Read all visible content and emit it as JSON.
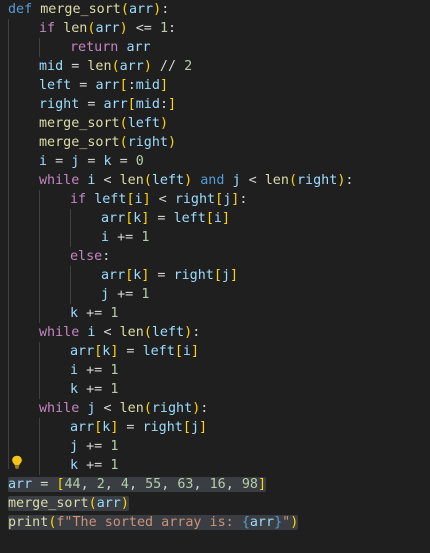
{
  "editor": {
    "language": "python",
    "indent_unit": "    ",
    "lines": [
      {
        "tokens": [
          [
            "kw",
            "def"
          ],
          [
            "op",
            " "
          ],
          [
            "fn",
            "merge_sort"
          ],
          [
            "br1",
            "("
          ],
          [
            "var",
            "arr"
          ],
          [
            "br1",
            ")"
          ],
          [
            "op",
            ":"
          ]
        ]
      },
      {
        "indent": 1,
        "tokens": [
          [
            "ctl",
            "if"
          ],
          [
            "op",
            " "
          ],
          [
            "fn",
            "len"
          ],
          [
            "br1",
            "("
          ],
          [
            "var",
            "arr"
          ],
          [
            "br1",
            ")"
          ],
          [
            "op",
            " <= "
          ],
          [
            "num",
            "1"
          ],
          [
            "op",
            ":"
          ]
        ]
      },
      {
        "indent": 2,
        "tokens": [
          [
            "ctl",
            "return"
          ],
          [
            "op",
            " "
          ],
          [
            "var",
            "arr"
          ]
        ]
      },
      {
        "indent": 1,
        "tokens": [
          [
            "var",
            "mid"
          ],
          [
            "op",
            " = "
          ],
          [
            "fn",
            "len"
          ],
          [
            "br1",
            "("
          ],
          [
            "var",
            "arr"
          ],
          [
            "br1",
            ")"
          ],
          [
            "op",
            " // "
          ],
          [
            "num",
            "2"
          ]
        ]
      },
      {
        "indent": 1,
        "tokens": [
          [
            "var",
            "left"
          ],
          [
            "op",
            " = "
          ],
          [
            "var",
            "arr"
          ],
          [
            "br1",
            "["
          ],
          [
            "op",
            ":"
          ],
          [
            "var",
            "mid"
          ],
          [
            "br1",
            "]"
          ]
        ]
      },
      {
        "indent": 1,
        "tokens": [
          [
            "var",
            "right"
          ],
          [
            "op",
            " = "
          ],
          [
            "var",
            "arr"
          ],
          [
            "br1",
            "["
          ],
          [
            "var",
            "mid"
          ],
          [
            "op",
            ":"
          ],
          [
            "br1",
            "]"
          ]
        ]
      },
      {
        "indent": 1,
        "tokens": [
          [
            "fn",
            "merge_sort"
          ],
          [
            "br1",
            "("
          ],
          [
            "var",
            "left"
          ],
          [
            "br1",
            ")"
          ]
        ]
      },
      {
        "indent": 1,
        "tokens": [
          [
            "fn",
            "merge_sort"
          ],
          [
            "br1",
            "("
          ],
          [
            "var",
            "right"
          ],
          [
            "br1",
            ")"
          ]
        ]
      },
      {
        "indent": 1,
        "tokens": [
          [
            "var",
            "i"
          ],
          [
            "op",
            " = "
          ],
          [
            "var",
            "j"
          ],
          [
            "op",
            " = "
          ],
          [
            "var",
            "k"
          ],
          [
            "op",
            " = "
          ],
          [
            "num",
            "0"
          ]
        ]
      },
      {
        "indent": 1,
        "tokens": [
          [
            "ctl",
            "while"
          ],
          [
            "op",
            " "
          ],
          [
            "var",
            "i"
          ],
          [
            "op",
            " < "
          ],
          [
            "fn",
            "len"
          ],
          [
            "br1",
            "("
          ],
          [
            "var",
            "left"
          ],
          [
            "br1",
            ")"
          ],
          [
            "op",
            " "
          ],
          [
            "kw",
            "and"
          ],
          [
            "op",
            " "
          ],
          [
            "var",
            "j"
          ],
          [
            "op",
            " < "
          ],
          [
            "fn",
            "len"
          ],
          [
            "br1",
            "("
          ],
          [
            "var",
            "right"
          ],
          [
            "br1",
            ")"
          ],
          [
            "op",
            ":"
          ]
        ]
      },
      {
        "indent": 2,
        "tokens": [
          [
            "ctl",
            "if"
          ],
          [
            "op",
            " "
          ],
          [
            "var",
            "left"
          ],
          [
            "br1",
            "["
          ],
          [
            "var",
            "i"
          ],
          [
            "br1",
            "]"
          ],
          [
            "op",
            " < "
          ],
          [
            "var",
            "right"
          ],
          [
            "br1",
            "["
          ],
          [
            "var",
            "j"
          ],
          [
            "br1",
            "]"
          ],
          [
            "op",
            ":"
          ]
        ]
      },
      {
        "indent": 3,
        "tokens": [
          [
            "var",
            "arr"
          ],
          [
            "br1",
            "["
          ],
          [
            "var",
            "k"
          ],
          [
            "br1",
            "]"
          ],
          [
            "op",
            " = "
          ],
          [
            "var",
            "left"
          ],
          [
            "br1",
            "["
          ],
          [
            "var",
            "i"
          ],
          [
            "br1",
            "]"
          ]
        ]
      },
      {
        "indent": 3,
        "tokens": [
          [
            "var",
            "i"
          ],
          [
            "op",
            " += "
          ],
          [
            "num",
            "1"
          ]
        ]
      },
      {
        "indent": 2,
        "tokens": [
          [
            "ctl",
            "else"
          ],
          [
            "op",
            ":"
          ]
        ]
      },
      {
        "indent": 3,
        "tokens": [
          [
            "var",
            "arr"
          ],
          [
            "br1",
            "["
          ],
          [
            "var",
            "k"
          ],
          [
            "br1",
            "]"
          ],
          [
            "op",
            " = "
          ],
          [
            "var",
            "right"
          ],
          [
            "br1",
            "["
          ],
          [
            "var",
            "j"
          ],
          [
            "br1",
            "]"
          ]
        ]
      },
      {
        "indent": 3,
        "tokens": [
          [
            "var",
            "j"
          ],
          [
            "op",
            " += "
          ],
          [
            "num",
            "1"
          ]
        ]
      },
      {
        "indent": 2,
        "tokens": [
          [
            "var",
            "k"
          ],
          [
            "op",
            " += "
          ],
          [
            "num",
            "1"
          ]
        ]
      },
      {
        "indent": 1,
        "tokens": [
          [
            "ctl",
            "while"
          ],
          [
            "op",
            " "
          ],
          [
            "var",
            "i"
          ],
          [
            "op",
            " < "
          ],
          [
            "fn",
            "len"
          ],
          [
            "br1",
            "("
          ],
          [
            "var",
            "left"
          ],
          [
            "br1",
            ")"
          ],
          [
            "op",
            ":"
          ]
        ]
      },
      {
        "indent": 2,
        "tokens": [
          [
            "var",
            "arr"
          ],
          [
            "br1",
            "["
          ],
          [
            "var",
            "k"
          ],
          [
            "br1",
            "]"
          ],
          [
            "op",
            " = "
          ],
          [
            "var",
            "left"
          ],
          [
            "br1",
            "["
          ],
          [
            "var",
            "i"
          ],
          [
            "br1",
            "]"
          ]
        ]
      },
      {
        "indent": 2,
        "tokens": [
          [
            "var",
            "i"
          ],
          [
            "op",
            " += "
          ],
          [
            "num",
            "1"
          ]
        ]
      },
      {
        "indent": 2,
        "tokens": [
          [
            "var",
            "k"
          ],
          [
            "op",
            " += "
          ],
          [
            "num",
            "1"
          ]
        ]
      },
      {
        "indent": 1,
        "tokens": [
          [
            "ctl",
            "while"
          ],
          [
            "op",
            " "
          ],
          [
            "var",
            "j"
          ],
          [
            "op",
            " < "
          ],
          [
            "fn",
            "len"
          ],
          [
            "br1",
            "("
          ],
          [
            "var",
            "right"
          ],
          [
            "br1",
            ")"
          ],
          [
            "op",
            ":"
          ]
        ]
      },
      {
        "indent": 2,
        "tokens": [
          [
            "var",
            "arr"
          ],
          [
            "br1",
            "["
          ],
          [
            "var",
            "k"
          ],
          [
            "br1",
            "]"
          ],
          [
            "op",
            " = "
          ],
          [
            "var",
            "right"
          ],
          [
            "br1",
            "["
          ],
          [
            "var",
            "j"
          ],
          [
            "br1",
            "]"
          ]
        ]
      },
      {
        "indent": 2,
        "tokens": [
          [
            "var",
            "j"
          ],
          [
            "op",
            " += "
          ],
          [
            "num",
            "1"
          ]
        ]
      },
      {
        "indent": 2,
        "tokens": [
          [
            "var",
            "k"
          ],
          [
            "op",
            " += "
          ],
          [
            "num",
            "1"
          ]
        ]
      },
      {
        "selected": true,
        "tokens": [
          [
            "var",
            "arr"
          ],
          [
            "op",
            " = "
          ],
          [
            "br1",
            "["
          ],
          [
            "num",
            "44"
          ],
          [
            "op",
            ", "
          ],
          [
            "num",
            "2"
          ],
          [
            "op",
            ", "
          ],
          [
            "num",
            "4"
          ],
          [
            "op",
            ", "
          ],
          [
            "num",
            "55"
          ],
          [
            "op",
            ", "
          ],
          [
            "num",
            "63"
          ],
          [
            "op",
            ", "
          ],
          [
            "num",
            "16"
          ],
          [
            "op",
            ", "
          ],
          [
            "num",
            "98"
          ],
          [
            "br1",
            "]"
          ]
        ]
      },
      {
        "selected": true,
        "tokens": [
          [
            "fn",
            "merge_sort"
          ],
          [
            "br1",
            "("
          ],
          [
            "var",
            "arr"
          ],
          [
            "br1",
            ")"
          ]
        ]
      },
      {
        "selected": true,
        "tokens": [
          [
            "fn",
            "print"
          ],
          [
            "br1",
            "("
          ],
          [
            "str",
            "f\"The sorted array is: "
          ],
          [
            "kw",
            "{"
          ],
          [
            "var",
            "arr"
          ],
          [
            "kw",
            "}"
          ],
          [
            "str",
            "\""
          ],
          [
            "br1",
            ")"
          ]
        ]
      }
    ],
    "lightbulb_icon": "lightbulb-icon",
    "colors": {
      "background": "#1f1f1f",
      "selection": "#3a3d41",
      "keyword": "#569cd6",
      "control": "#c586c0",
      "function": "#dcdcaa",
      "variable": "#9cdcfe",
      "number": "#b5cea8",
      "string": "#ce9178",
      "bracket": "#ffd700"
    }
  }
}
